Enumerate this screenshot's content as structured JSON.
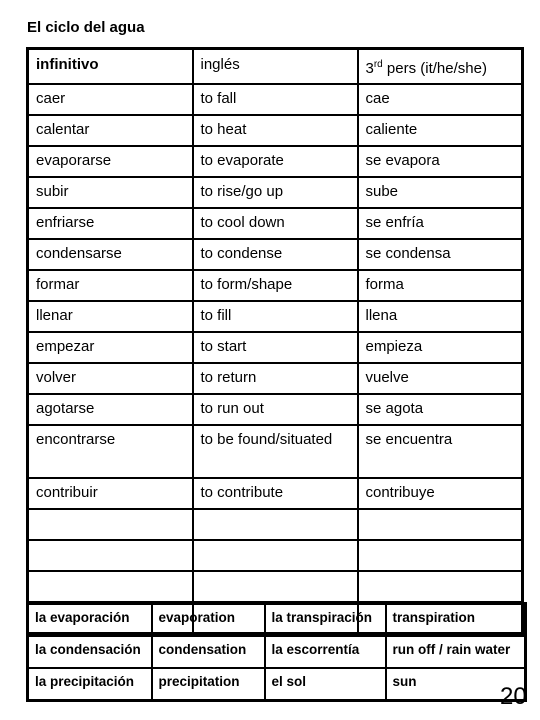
{
  "document": {
    "title": "El ciclo del agua",
    "page_number": "20"
  },
  "verb_table": {
    "headers": {
      "infinitive": "infinitivo",
      "english": "inglés",
      "third_person_prefix": "3",
      "third_person_sup": "rd",
      "third_person_suffix": " pers (it/he/she)"
    },
    "rows": [
      {
        "infinitive": "caer",
        "english": "to fall",
        "third_person": "cae"
      },
      {
        "infinitive": "calentar",
        "english": "to heat",
        "third_person": "caliente"
      },
      {
        "infinitive": "evaporarse",
        "english": "to evaporate",
        "third_person": "se evapora"
      },
      {
        "infinitive": "subir",
        "english": "to rise/go up",
        "third_person": "sube"
      },
      {
        "infinitive": "enfriarse",
        "english": "to cool down",
        "third_person": "se enfría"
      },
      {
        "infinitive": "condensarse",
        "english": "to condense",
        "third_person": "se condensa"
      },
      {
        "infinitive": "formar",
        "english": "to form/shape",
        "third_person": "forma"
      },
      {
        "infinitive": "llenar",
        "english": "to fill",
        "third_person": "llena"
      },
      {
        "infinitive": "empezar",
        "english": "to start",
        "third_person": "empieza"
      },
      {
        "infinitive": "volver",
        "english": "to return",
        "third_person": "vuelve"
      },
      {
        "infinitive": "agotarse",
        "english": "to run out",
        "third_person": "se agota"
      },
      {
        "infinitive": "encontrarse",
        "english": "to be found/situated",
        "third_person": "se encuentra"
      },
      {
        "infinitive": "contribuir",
        "english": "to contribute",
        "third_person": "contribuye"
      }
    ],
    "empty_rows": 4
  },
  "glossary_table": {
    "rows": [
      {
        "spanish_1": "la evaporación",
        "english_1": "evaporation",
        "spanish_2": "la transpiración",
        "english_2": "transpiration"
      },
      {
        "spanish_1": "la condensación",
        "english_1": "condensation",
        "spanish_2": "la escorrentía",
        "english_2": "run off / rain water"
      },
      {
        "spanish_1": "la precipitación",
        "english_1": "precipitation",
        "spanish_2": "el sol",
        "english_2": "sun"
      }
    ]
  }
}
